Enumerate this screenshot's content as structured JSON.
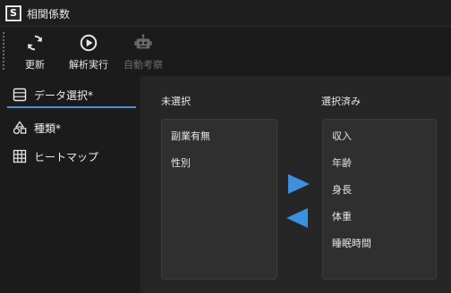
{
  "window": {
    "title": "相関係数",
    "logo_letter": "S"
  },
  "toolbar": {
    "update_label": "更新",
    "analyze_label": "解析実行",
    "auto_label": "自動考察"
  },
  "sidebar": {
    "items": [
      {
        "label": "データ選択*",
        "icon": "list-icon",
        "active": true
      },
      {
        "label": "種類*",
        "icon": "shapes-icon",
        "active": false
      },
      {
        "label": "ヒートマップ",
        "icon": "grid-icon",
        "active": false
      }
    ]
  },
  "main": {
    "unselected_title": "未選択",
    "selected_title": "選択済み",
    "unselected_items": [
      "副業有無",
      "性別"
    ],
    "selected_items": [
      "収入",
      "年齢",
      "身長",
      "体重",
      "睡眠時間"
    ]
  },
  "colors": {
    "accent": "#4a90d9",
    "arrow": "#3d8fe0",
    "background": "#1b1b1b",
    "panel": "#262626"
  }
}
